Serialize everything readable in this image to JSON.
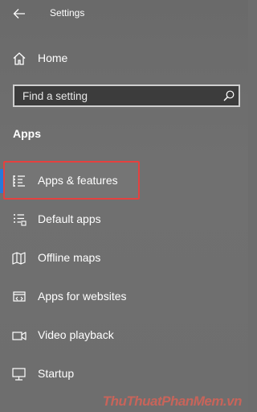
{
  "window": {
    "title": "Settings",
    "back_icon": "arrow-left-icon"
  },
  "home": {
    "label": "Home",
    "icon": "home-icon"
  },
  "search": {
    "placeholder": "Find a setting",
    "value": "",
    "icon": "search-icon"
  },
  "section": {
    "title": "Apps"
  },
  "nav": {
    "items": [
      {
        "label": "Apps & features",
        "icon": "apps-list-icon",
        "selected": true
      },
      {
        "label": "Default apps",
        "icon": "default-apps-icon",
        "selected": false
      },
      {
        "label": "Offline maps",
        "icon": "map-icon",
        "selected": false
      },
      {
        "label": "Apps for websites",
        "icon": "apps-websites-icon",
        "selected": false
      },
      {
        "label": "Video playback",
        "icon": "video-icon",
        "selected": false
      },
      {
        "label": "Startup",
        "icon": "startup-icon",
        "selected": false
      }
    ]
  },
  "colors": {
    "background": "#6d6d6d",
    "accent": "#2979d8",
    "highlight_border": "#e5413f",
    "text": "#ffffff"
  },
  "watermark": {
    "text": "ThuThuatPhanMem.vn"
  }
}
